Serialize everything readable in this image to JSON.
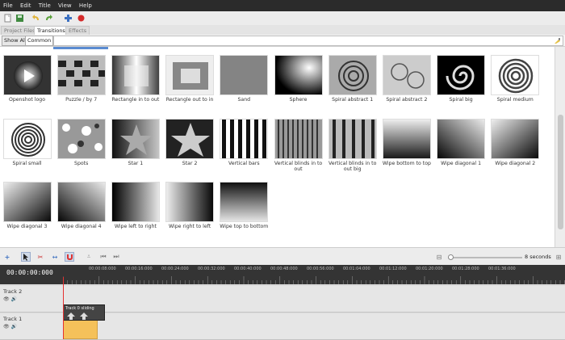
{
  "menu": [
    "File",
    "Edit",
    "Title",
    "View",
    "Help"
  ],
  "tabs": [
    {
      "label": "Project Files",
      "active": false
    },
    {
      "label": "Transitions",
      "active": true
    },
    {
      "label": "Effects",
      "active": false
    }
  ],
  "filter": {
    "show_all": "Show All",
    "common": "Common",
    "search_placeholder": ""
  },
  "transitions": [
    {
      "label": "Openshot logo",
      "kind": "logo"
    },
    {
      "label": "Puzzle / by 7",
      "kind": "puzzle"
    },
    {
      "label": "Rectangle in to out",
      "kind": "rect-in"
    },
    {
      "label": "Rectangle out to in",
      "kind": "rect-out"
    },
    {
      "label": "Sand",
      "kind": "sand"
    },
    {
      "label": "Sphere",
      "kind": "sphere"
    },
    {
      "label": "Spiral abstract 1",
      "kind": "spiral-abs"
    },
    {
      "label": "Spiral abstract 2",
      "kind": "spiral-abs2"
    },
    {
      "label": "Spiral big",
      "kind": "spiral-big"
    },
    {
      "label": "Spiral medium",
      "kind": "spiral-med"
    },
    {
      "label": "Spiral small",
      "kind": "spiral-small"
    },
    {
      "label": "Spots",
      "kind": "spots"
    },
    {
      "label": "Star 1",
      "kind": "star1"
    },
    {
      "label": "Star 2",
      "kind": "star2"
    },
    {
      "label": "Vertical bars",
      "kind": "vbars"
    },
    {
      "label": "Vertical blinds in to out",
      "kind": "vblinds"
    },
    {
      "label": "Vertical blinds in to out big",
      "kind": "vblinds-big"
    },
    {
      "label": "Wipe bottom to top",
      "kind": "wipe-bt"
    },
    {
      "label": "Wipe diagonal 1",
      "kind": "wipe-d1"
    },
    {
      "label": "Wipe diagonal 2",
      "kind": "wipe-d2"
    },
    {
      "label": "Wipe diagonal 3",
      "kind": "wipe-d3"
    },
    {
      "label": "Wipe diagonal 4",
      "kind": "wipe-d4"
    },
    {
      "label": "Wipe left to right",
      "kind": "wipe-lr"
    },
    {
      "label": "Wipe right to left",
      "kind": "wipe-rl"
    },
    {
      "label": "Wipe top to bottom",
      "kind": "wipe-tb"
    }
  ],
  "timeline": {
    "zoom_label": "8 seconds",
    "timecode": "00:00:00:000",
    "ticks": [
      "00:00:08:000",
      "00:00:16:000",
      "00:00:24:000",
      "00:00:32:000",
      "00:00:40:000",
      "00:00:48:000",
      "00:00:56:000",
      "00:01:04:000",
      "00:01:12:000",
      "00:01:20:000",
      "00:01:28:000",
      "00:01:36:000"
    ],
    "tracks": [
      {
        "name": "Track 2"
      },
      {
        "name": "Track 1"
      }
    ],
    "tooltip": "Track 0 sliding",
    "clip_label": "Sliding"
  },
  "colors": {
    "accent": "#5a8bd1",
    "clip": "#f5c15a",
    "playhead": "#e53030"
  }
}
